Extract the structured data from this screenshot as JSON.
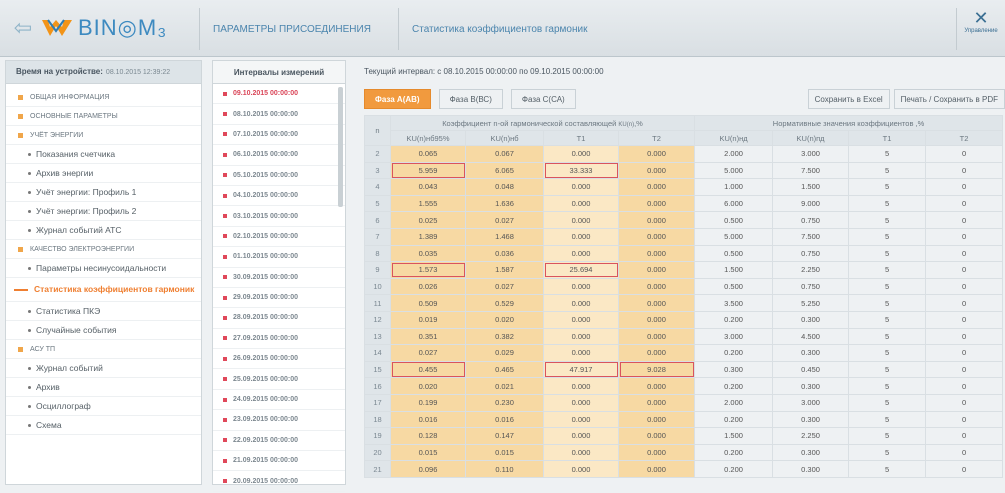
{
  "header": {
    "back_icon": "back-arrow-icon",
    "logo_text": "BIN◎M₃",
    "tab_connection": "ПАРАМЕТРЫ ПРИСОЕДИНЕНИЯ",
    "tab_stats": "Статистика коэффициентов гармоник",
    "manage_label": "Управление",
    "manage_icon": "tools-icon"
  },
  "sidebar": {
    "device_time_label": "Время на устройстве:",
    "device_time_value": "08.10.2015 12:39:22",
    "items": [
      {
        "label": "ОБЩАЯ ИНФОРМАЦИЯ",
        "kind": "sec"
      },
      {
        "label": "ОСНОВНЫЕ ПАРАМЕТРЫ",
        "kind": "sec"
      },
      {
        "label": "УЧЁТ ЭНЕРГИИ",
        "kind": "sec"
      },
      {
        "label": "Показания счетчика",
        "kind": "sub"
      },
      {
        "label": "Архив энергии",
        "kind": "sub"
      },
      {
        "label": "Учёт энергии: Профиль 1",
        "kind": "sub"
      },
      {
        "label": "Учёт энергии: Профиль 2",
        "kind": "sub"
      },
      {
        "label": "Журнал событий АТС",
        "kind": "sub"
      },
      {
        "label": "КАЧЕСТВО ЭЛЕКТРОЭНЕРГИИ",
        "kind": "sec"
      },
      {
        "label": "Параметры несинусоидальности",
        "kind": "sub"
      },
      {
        "label": "Статистика коэффициентов гармоник",
        "kind": "active"
      },
      {
        "label": "Статистика ПКЭ",
        "kind": "sub"
      },
      {
        "label": "Случайные события",
        "kind": "sub"
      },
      {
        "label": "АСУ ТП",
        "kind": "sec"
      },
      {
        "label": "Журнал событий",
        "kind": "sub"
      },
      {
        "label": "Архив",
        "kind": "sub"
      },
      {
        "label": "Осциллограф",
        "kind": "sub"
      },
      {
        "label": "Схема",
        "kind": "sub"
      }
    ]
  },
  "intervals": {
    "title": "Интервалы измерений",
    "items": [
      "09.10.2015 00:00:00",
      "08.10.2015 00:00:00",
      "07.10.2015 00:00:00",
      "06.10.2015 00:00:00",
      "05.10.2015 00:00:00",
      "04.10.2015 00:00:00",
      "03.10.2015 00:00:00",
      "02.10.2015 00:00:00",
      "01.10.2015 00:00:00",
      "30.09.2015 00:00:00",
      "29.09.2015 00:00:00",
      "28.09.2015 00:00:00",
      "27.09.2015 00:00:00",
      "26.09.2015 00:00:00",
      "25.09.2015 00:00:00",
      "24.09.2015 00:00:00",
      "23.09.2015 00:00:00",
      "22.09.2015 00:00:00",
      "21.09.2015 00:00:00",
      "20.09.2015 00:00:00"
    ]
  },
  "main": {
    "current_interval": "Текущий интервал: с 08.10.2015 00:00:00 по 09.10.2015 00:00:00",
    "phase_tabs": [
      "Фаза А(АВ)",
      "Фаза В(ВС)",
      "Фаза С(СА)"
    ],
    "save_excel": "Сохранить в Excel",
    "print_pdf": "Печать / Сохранить в PDF",
    "group1": "Коэффициент n-ой гармонической составляющей",
    "group1_sub": "KU(n)",
    "group1_unit": ",%",
    "group2": "Нормативные значения коэффициентов ,%",
    "cols": [
      "n",
      "KU(n)нб95%",
      "KU(n)нб",
      "T1",
      "T2",
      "KU(n)нд",
      "KU(n)пд",
      "T1",
      "T2"
    ],
    "rows": [
      [
        "2",
        "0.065",
        "0.067",
        "0.000",
        "0.000",
        "2.000",
        "3.000",
        "5",
        "0"
      ],
      [
        "3",
        "5.959",
        "6.065",
        "33.333",
        "0.000",
        "5.000",
        "7.500",
        "5",
        "0"
      ],
      [
        "4",
        "0.043",
        "0.048",
        "0.000",
        "0.000",
        "1.000",
        "1.500",
        "5",
        "0"
      ],
      [
        "5",
        "1.555",
        "1.636",
        "0.000",
        "0.000",
        "6.000",
        "9.000",
        "5",
        "0"
      ],
      [
        "6",
        "0.025",
        "0.027",
        "0.000",
        "0.000",
        "0.500",
        "0.750",
        "5",
        "0"
      ],
      [
        "7",
        "1.389",
        "1.468",
        "0.000",
        "0.000",
        "5.000",
        "7.500",
        "5",
        "0"
      ],
      [
        "8",
        "0.035",
        "0.036",
        "0.000",
        "0.000",
        "0.500",
        "0.750",
        "5",
        "0"
      ],
      [
        "9",
        "1.573",
        "1.587",
        "25.694",
        "0.000",
        "1.500",
        "2.250",
        "5",
        "0"
      ],
      [
        "10",
        "0.026",
        "0.027",
        "0.000",
        "0.000",
        "0.500",
        "0.750",
        "5",
        "0"
      ],
      [
        "11",
        "0.509",
        "0.529",
        "0.000",
        "0.000",
        "3.500",
        "5.250",
        "5",
        "0"
      ],
      [
        "12",
        "0.019",
        "0.020",
        "0.000",
        "0.000",
        "0.200",
        "0.300",
        "5",
        "0"
      ],
      [
        "13",
        "0.351",
        "0.382",
        "0.000",
        "0.000",
        "3.000",
        "4.500",
        "5",
        "0"
      ],
      [
        "14",
        "0.027",
        "0.029",
        "0.000",
        "0.000",
        "0.200",
        "0.300",
        "5",
        "0"
      ],
      [
        "15",
        "0.455",
        "0.465",
        "47.917",
        "9.028",
        "0.300",
        "0.450",
        "5",
        "0"
      ],
      [
        "16",
        "0.020",
        "0.021",
        "0.000",
        "0.000",
        "0.200",
        "0.300",
        "5",
        "0"
      ],
      [
        "17",
        "0.199",
        "0.230",
        "0.000",
        "0.000",
        "2.000",
        "3.000",
        "5",
        "0"
      ],
      [
        "18",
        "0.016",
        "0.016",
        "0.000",
        "0.000",
        "0.200",
        "0.300",
        "5",
        "0"
      ],
      [
        "19",
        "0.128",
        "0.147",
        "0.000",
        "0.000",
        "1.500",
        "2.250",
        "5",
        "0"
      ],
      [
        "20",
        "0.015",
        "0.015",
        "0.000",
        "0.000",
        "0.200",
        "0.300",
        "5",
        "0"
      ],
      [
        "21",
        "0.096",
        "0.110",
        "0.000",
        "0.000",
        "0.200",
        "0.300",
        "5",
        "0"
      ]
    ],
    "highlight_rows": [
      "3",
      "9",
      "15"
    ]
  },
  "colors": {
    "accent": "#f19a3e",
    "brand": "#3d8ac0",
    "active_nav": "#ef7f31",
    "marker": "#e0485a"
  }
}
